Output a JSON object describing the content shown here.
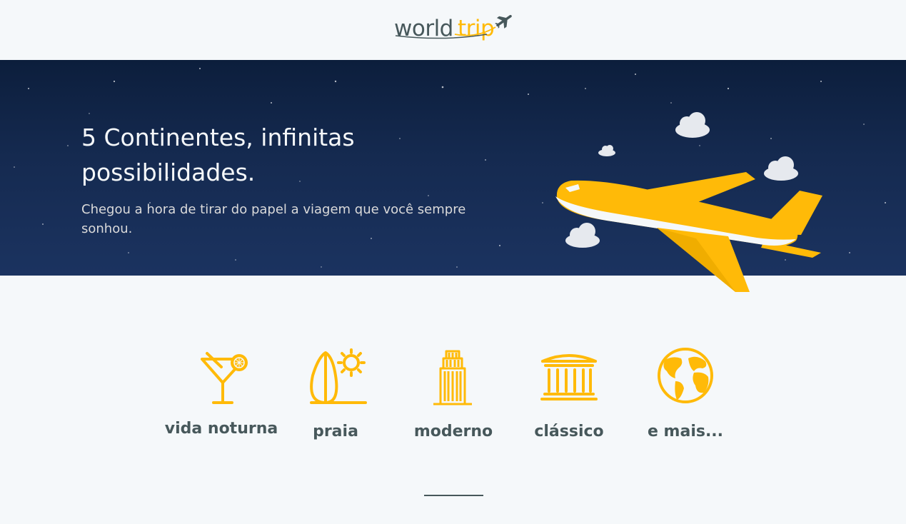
{
  "header": {
    "logo_world": "world",
    "logo_trip": "trip",
    "logo_icon": "airplane-icon"
  },
  "banner": {
    "title": "5 Continentes, infinitas possibilidades.",
    "subtitle": "Chegou a hora de tirar do papel a viagem que você sempre sonhou.",
    "illustration": "airplane-illustration"
  },
  "categories": [
    {
      "label": "vida noturna",
      "icon": "cocktail-icon"
    },
    {
      "label": "praia",
      "icon": "surfboard-sun-icon"
    },
    {
      "label": "moderno",
      "icon": "building-icon"
    },
    {
      "label": "clássico",
      "icon": "museum-icon"
    },
    {
      "label": "e mais...",
      "icon": "globe-icon"
    }
  ],
  "colors": {
    "accent": "#FFBA08",
    "text_dark": "#47585B",
    "background": "#F5F8FA",
    "banner_bg": "#0C1E3C",
    "light_text": "#F5F8FA"
  }
}
